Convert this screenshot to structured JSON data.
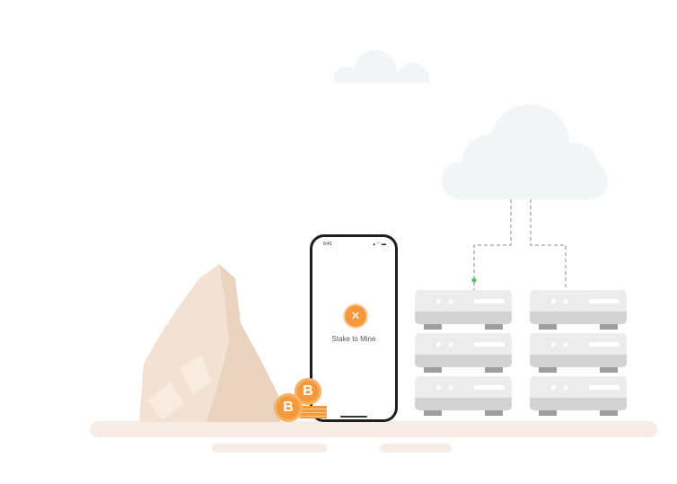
{
  "phone": {
    "time": "9:41",
    "status_icons": "signal-wifi-battery",
    "app_title": "Stake to Mine",
    "logo_icon": "stake-logo-icon"
  },
  "coins": {
    "symbol": "B"
  },
  "colors": {
    "accent": "#f59a3c",
    "cloud": "#f2f4f5",
    "ground": "#f6ece4",
    "rock": "#f0dfd0",
    "link_dot": "#4cc06a"
  }
}
